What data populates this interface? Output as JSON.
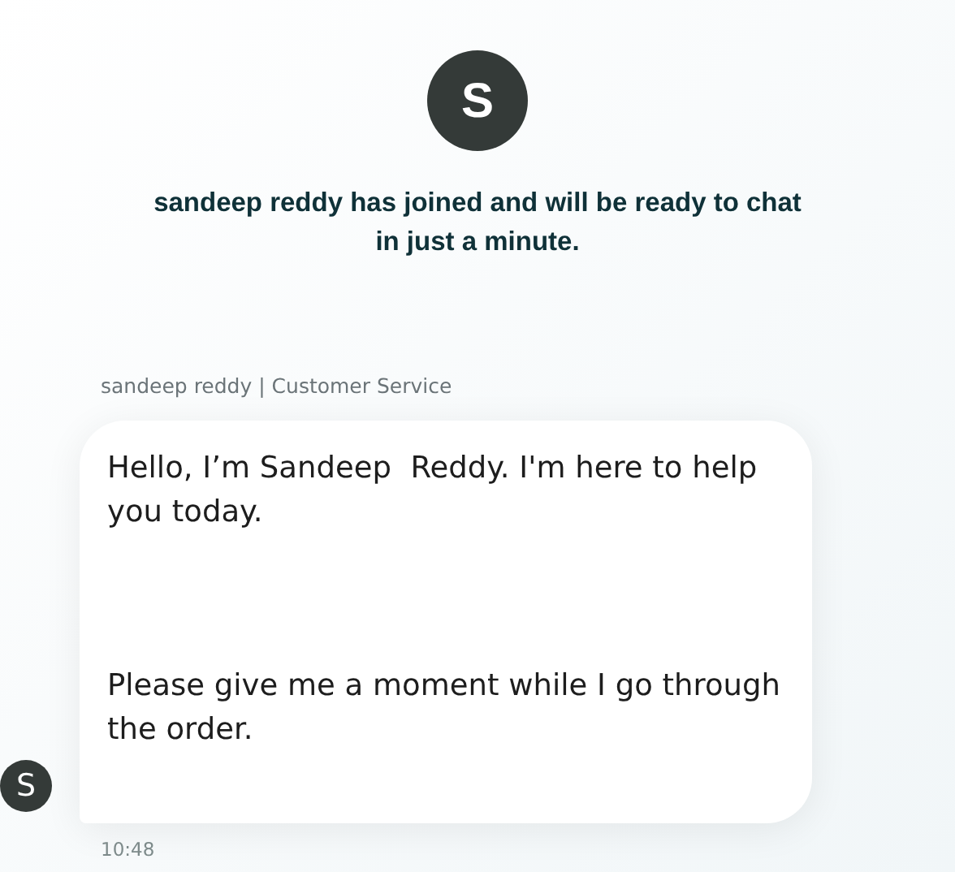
{
  "agent_avatar": {
    "initial": "S"
  },
  "join_notice": "sandeep reddy has joined and will be ready to chat in just a minute.",
  "message": {
    "sender": "sandeep reddy | Customer Service",
    "paragraphs": [
      "Hello, I’m Sandeep  Reddy. I'm here to help you today.",
      "Please give me a moment while I go through the order."
    ],
    "avatar_initial": "S",
    "time": "10:48"
  }
}
